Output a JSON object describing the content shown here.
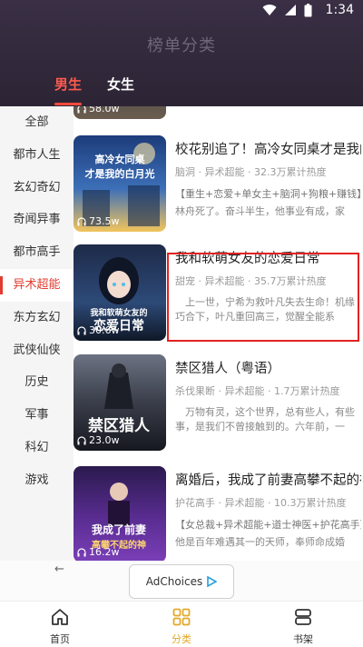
{
  "status": {
    "time": "1:34"
  },
  "header": {
    "title": "榜单分类"
  },
  "tabs": [
    {
      "label": "男生",
      "active": true
    },
    {
      "label": "女生",
      "active": false
    }
  ],
  "sidebar": {
    "items": [
      {
        "label": "全部"
      },
      {
        "label": "都市人生"
      },
      {
        "label": "玄幻奇幻"
      },
      {
        "label": "奇闻异事"
      },
      {
        "label": "都市高手"
      },
      {
        "label": "异术超能"
      },
      {
        "label": "东方玄幻"
      },
      {
        "label": "武侠仙侠"
      },
      {
        "label": "历史"
      },
      {
        "label": "军事"
      },
      {
        "label": "科幻"
      },
      {
        "label": "游戏"
      }
    ],
    "active_index": 5
  },
  "books": [
    {
      "heat": "58.0w",
      "title": "",
      "meta": "",
      "tags": "",
      "desc": "",
      "cover_top": "#2a2b3a",
      "cover_bottom": "#6a5d4f"
    },
    {
      "heat": "73.5w",
      "cover_text": "高冷女同桌才是我的白月光",
      "title": "校花别追了！高冷女同桌才是我的",
      "meta": "脑洞 · 异术超能 · 32.3万累计热度",
      "tags": "【重生+恋爱+单女主+脑洞+狗粮+赚钱】",
      "desc": "林舟死了。奋斗半生，他事业有成，家财…",
      "cover_top": "#1d3c7a",
      "cover_bottom": "#f2c45c"
    },
    {
      "heat": "30.6w",
      "cover_text": "我和软萌女友的恋爱日常",
      "title": "我和软萌女友的恋爱日常",
      "meta": "甜宠 · 异术超能 · 35.7万累计热度",
      "tags": "",
      "desc": "上一世，宁希为救叶凡失去生命！机缘巧合下，叶凡重回高三，觉醒全能系统，…",
      "cover_top": "#1e2a48",
      "cover_bottom": "#3a5c8e"
    },
    {
      "heat": "23.0w",
      "cover_text": "禁区猎人",
      "title": "禁区猎人（粤语）",
      "meta": "杀伐果断 · 异术超能 · 1.7万累计热度",
      "tags": "",
      "desc": "万物有灵，这个世界，总有些人，有些事，是我们不曾接触到的。六年前，一个…",
      "cover_top": "#5a6070",
      "cover_bottom": "#1b1d24"
    },
    {
      "heat": "16.2w",
      "cover_text": "我成了前妻高攀不起的神",
      "title": "离婚后，我成了前妻高攀不起的神",
      "meta": "护花高手 · 异术超能 · 10.3万累计热度",
      "tags": "【女总裁+异术超能+道士神医+护花高手】",
      "desc": "他是百年难遇其一的天师，奉师命成婚三…",
      "cover_top": "#2b1a4e",
      "cover_bottom": "#7b3fb8"
    }
  ],
  "ad": {
    "label": "AdChoices"
  },
  "bottom_nav": [
    {
      "label": "首页",
      "icon": "home-icon"
    },
    {
      "label": "分类",
      "icon": "category-icon",
      "active": true
    },
    {
      "label": "书架",
      "icon": "bookshelf-icon"
    }
  ]
}
